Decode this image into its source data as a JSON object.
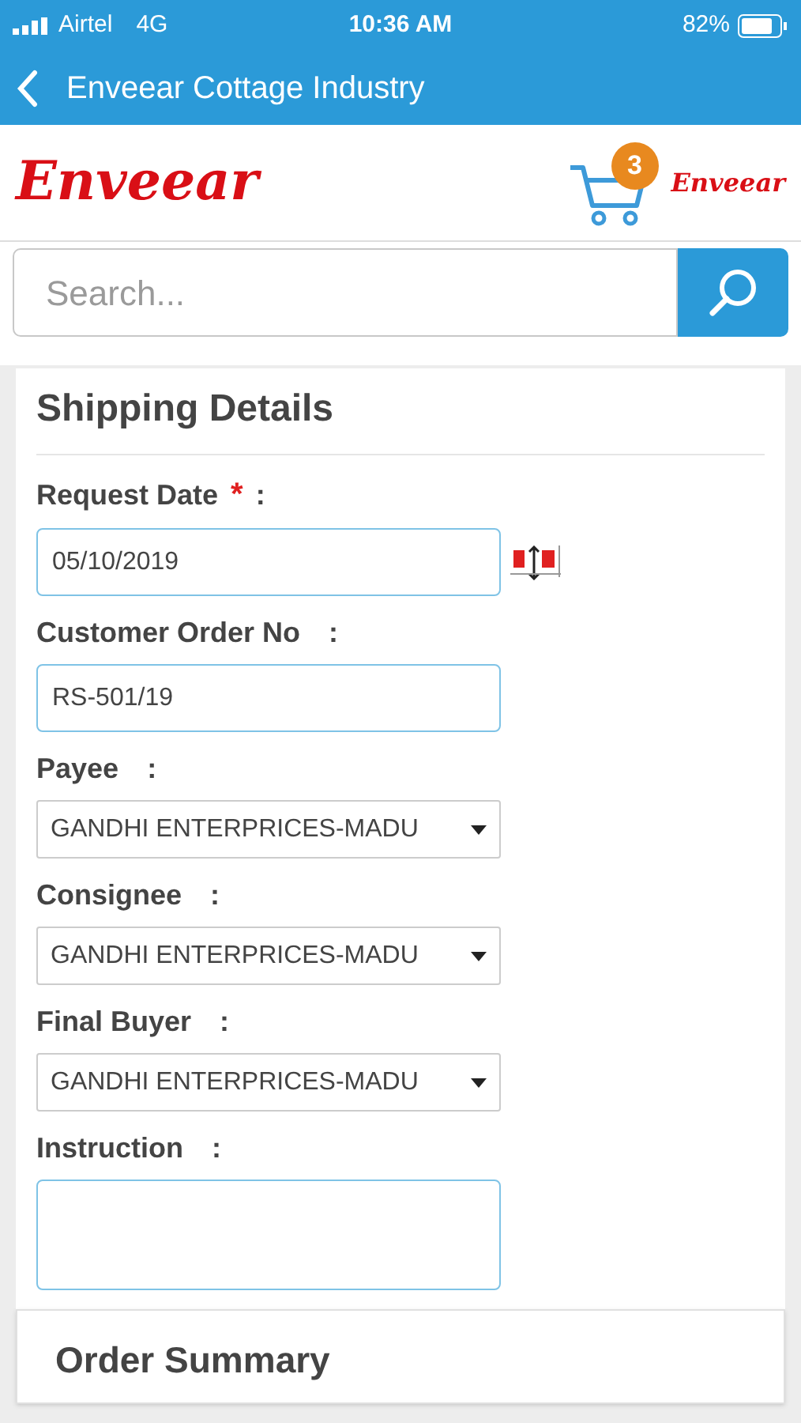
{
  "status_bar": {
    "carrier": "Airtel",
    "network": "4G",
    "time": "10:36 AM",
    "battery": "82%"
  },
  "nav": {
    "title": "Enveear Cottage Industry"
  },
  "header": {
    "logo": "Enveear",
    "cart_count": "3",
    "small_logo": "Enveear"
  },
  "search": {
    "placeholder": "Search..."
  },
  "shipping": {
    "title": "Shipping Details",
    "fields": [
      {
        "kind": "date",
        "label": "Request Date",
        "required_mark": "*",
        "colon": ":",
        "value": "05/10/2019"
      },
      {
        "kind": "text",
        "label": "Customer Order No",
        "colon": ":",
        "value": "RS-501/19"
      },
      {
        "kind": "select",
        "label": "Payee",
        "colon": ":",
        "value": "GANDHI ENTERPRICES-MADU"
      },
      {
        "kind": "select",
        "label": "Consignee",
        "colon": ":",
        "value": "GANDHI ENTERPRICES-MADU"
      },
      {
        "kind": "select",
        "label": "Final Buyer",
        "colon": ":",
        "value": "GANDHI ENTERPRICES-MADU"
      },
      {
        "kind": "textarea",
        "label": "Instruction",
        "colon": ":"
      }
    ]
  },
  "order_summary": {
    "title": "Order Summary"
  }
}
